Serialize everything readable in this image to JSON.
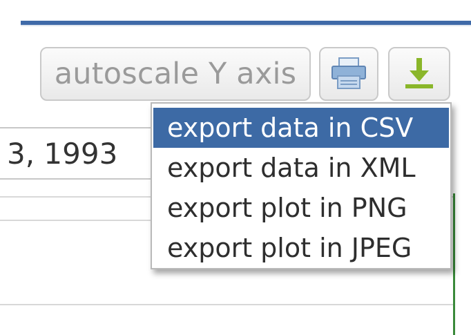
{
  "toolbar": {
    "autoscale_label": "autoscale Y axis",
    "print_icon": "print-icon",
    "download_icon": "download-icon"
  },
  "date_field": {
    "value": "3, 1993"
  },
  "export_menu": {
    "items": [
      {
        "label": "export data in CSV",
        "selected": true
      },
      {
        "label": "export data in XML",
        "selected": false
      },
      {
        "label": "export plot in PNG",
        "selected": false
      },
      {
        "label": "export plot in JPEG",
        "selected": false
      }
    ]
  },
  "colors": {
    "accent": "#3d6aa5",
    "download_arrow": "#8ab62a",
    "print_icon": "#8fb2d8",
    "plot_line": "#3a8a3a"
  }
}
